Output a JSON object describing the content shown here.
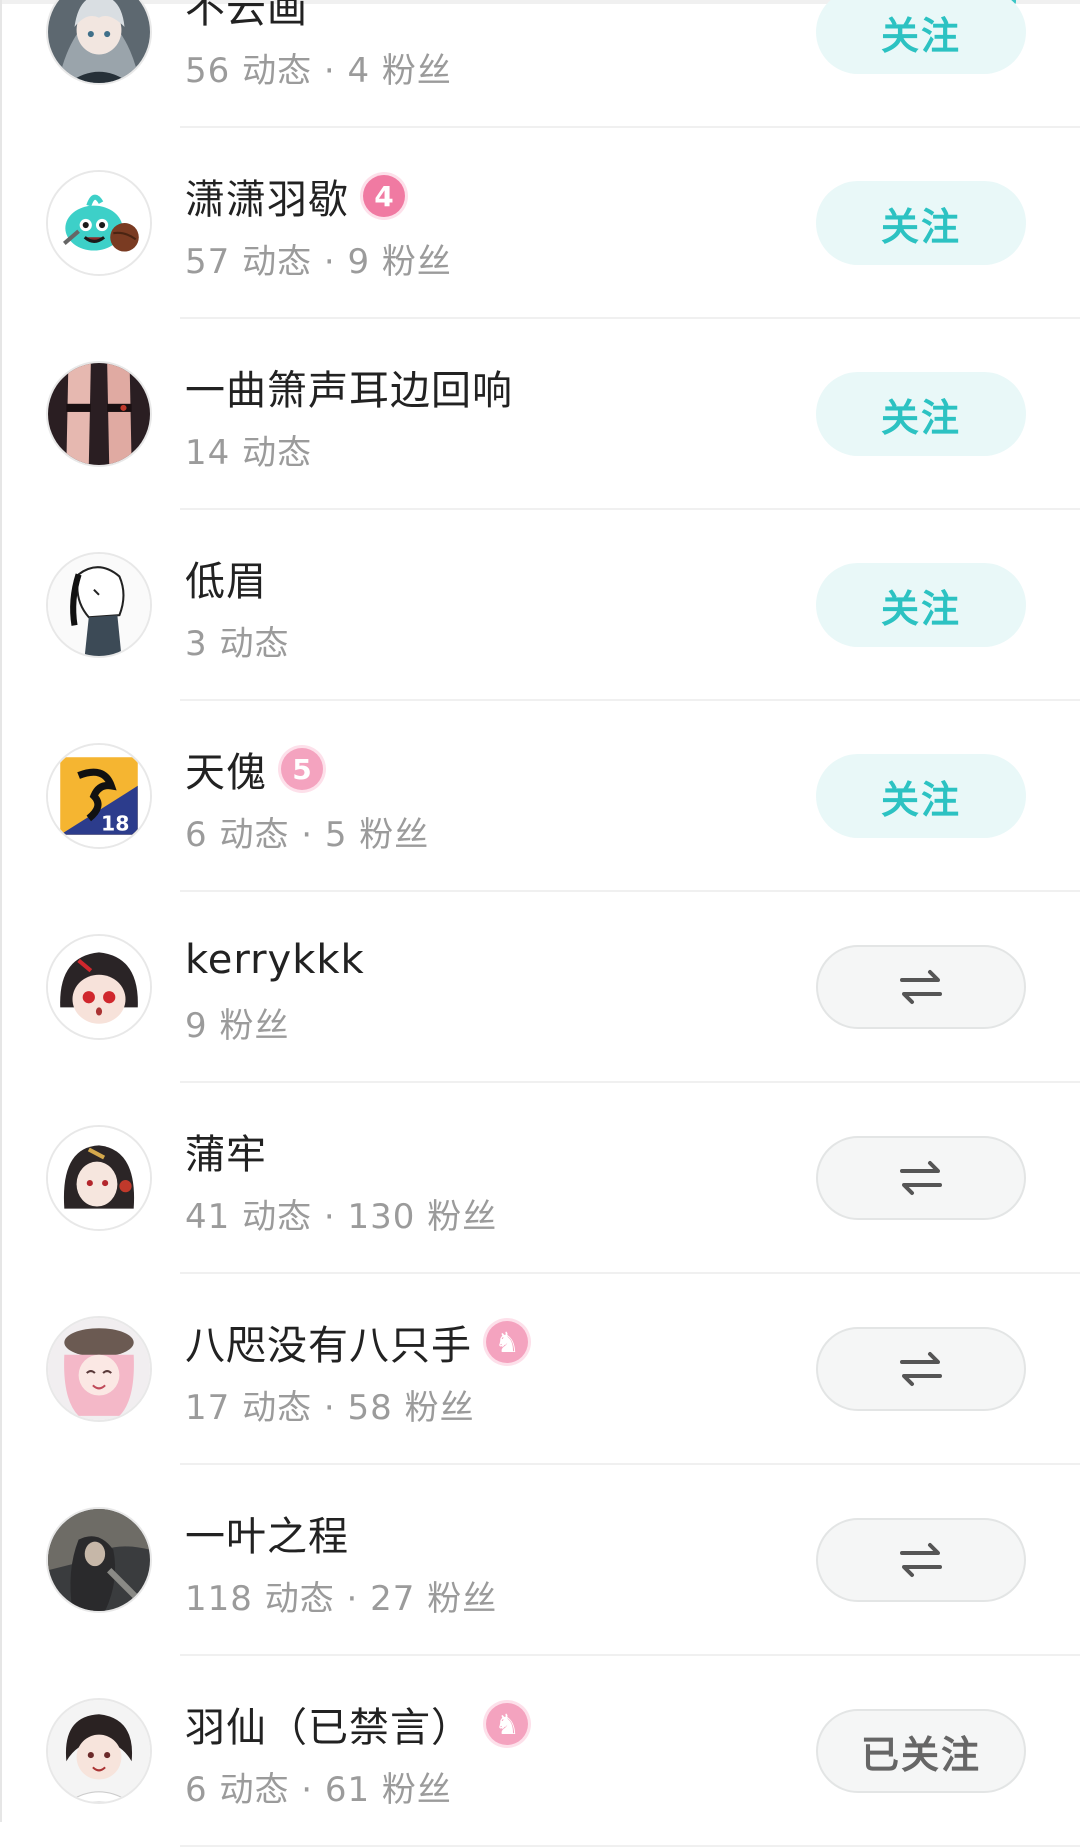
{
  "colors": {
    "accent": "#2cc2c2",
    "follow_bg": "#e9f8f8",
    "badge_pink": "#f07aa2",
    "text_primary": "#222222",
    "text_secondary": "#9b9b9b"
  },
  "users": [
    {
      "name": "不云画",
      "stats": "56 动态 · 4 粉丝",
      "badge": "",
      "button": {
        "type": "follow",
        "label": "关注"
      },
      "avatar_icon": "avatar-anime-silver-hair"
    },
    {
      "name": "潇潇羽歇",
      "stats": "57 动态 · 9 粉丝",
      "badge": "4",
      "button": {
        "type": "follow",
        "label": "关注"
      },
      "avatar_icon": "avatar-teal-slime"
    },
    {
      "name": "一曲箫声耳边回响",
      "stats": "14 动态",
      "badge": "",
      "button": {
        "type": "follow",
        "label": "关注"
      },
      "avatar_icon": "avatar-dark-figure"
    },
    {
      "name": "低眉",
      "stats": "3 动态",
      "badge": "",
      "button": {
        "type": "follow",
        "label": "关注"
      },
      "avatar_icon": "avatar-sketch-character"
    },
    {
      "name": "天傀",
      "stats": "6 动态 · 5 粉丝",
      "badge": "5",
      "button": {
        "type": "follow",
        "label": "关注"
      },
      "avatar_icon": "avatar-dragon-logo-18"
    },
    {
      "name": "kerrykkk",
      "stats": "9 粉丝",
      "badge": "",
      "button": {
        "type": "mutual",
        "label": ""
      },
      "avatar_icon": "avatar-chibi-red-eyes"
    },
    {
      "name": "蒲牢",
      "stats": "41 动态 · 130 粉丝",
      "badge": "",
      "button": {
        "type": "mutual",
        "label": ""
      },
      "avatar_icon": "avatar-anime-dark-hair"
    },
    {
      "name": "八咫没有八只手",
      "stats": "17 动态 · 58 粉丝",
      "badge": "♞",
      "button": {
        "type": "mutual",
        "label": ""
      },
      "avatar_icon": "avatar-pink-hair-beret"
    },
    {
      "name": "一叶之程",
      "stats": "118 动态 · 27 粉丝",
      "badge": "",
      "button": {
        "type": "mutual",
        "label": ""
      },
      "avatar_icon": "avatar-dark-painting"
    },
    {
      "name": "羽仙（已禁言）",
      "stats": "6 动态 · 61 粉丝",
      "badge": "♞",
      "button": {
        "type": "followed",
        "label": "已关注"
      },
      "avatar_icon": "avatar-anime-boy"
    }
  ]
}
